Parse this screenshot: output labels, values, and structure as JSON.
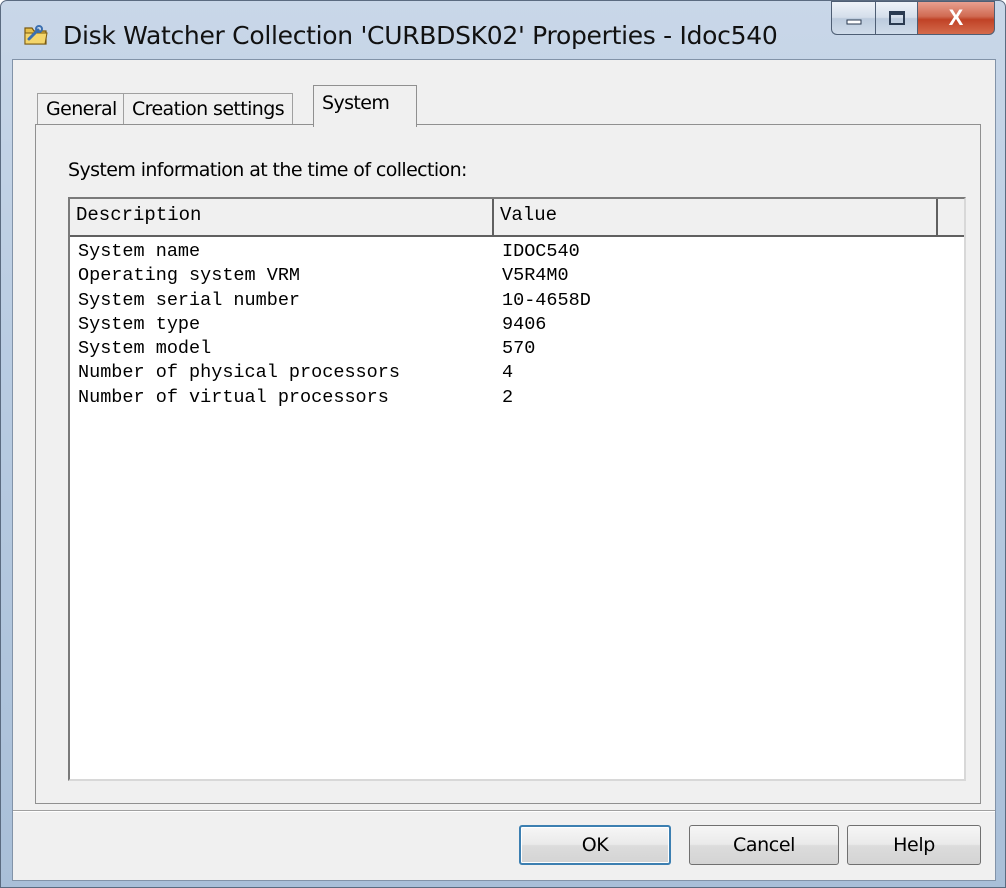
{
  "window": {
    "title": "Disk Watcher Collection 'CURBDSK02' Properties - Idoc540",
    "icon": "folder-wrench-icon",
    "close_glyph": "X"
  },
  "tabs": [
    {
      "label": "General",
      "active": false
    },
    {
      "label": "Creation settings",
      "active": false
    },
    {
      "label": "System",
      "active": true
    }
  ],
  "panel": {
    "label": "System information at the time of collection:",
    "columns": [
      "Description",
      "Value"
    ],
    "rows": [
      {
        "description": "System name",
        "value": "IDOC540"
      },
      {
        "description": "Operating system VRM",
        "value": "V5R4M0"
      },
      {
        "description": "System serial number",
        "value": "10-4658D"
      },
      {
        "description": "System type",
        "value": "9406"
      },
      {
        "description": "System model",
        "value": "570"
      },
      {
        "description": "Number of physical processors",
        "value": "4"
      },
      {
        "description": "Number of virtual processors",
        "value": "2"
      }
    ]
  },
  "buttons": {
    "ok": "OK",
    "cancel": "Cancel",
    "help": "Help"
  },
  "colors": {
    "accent": "#3c7fb1",
    "close_button": "#c04226",
    "frame": "#b9cce2"
  }
}
